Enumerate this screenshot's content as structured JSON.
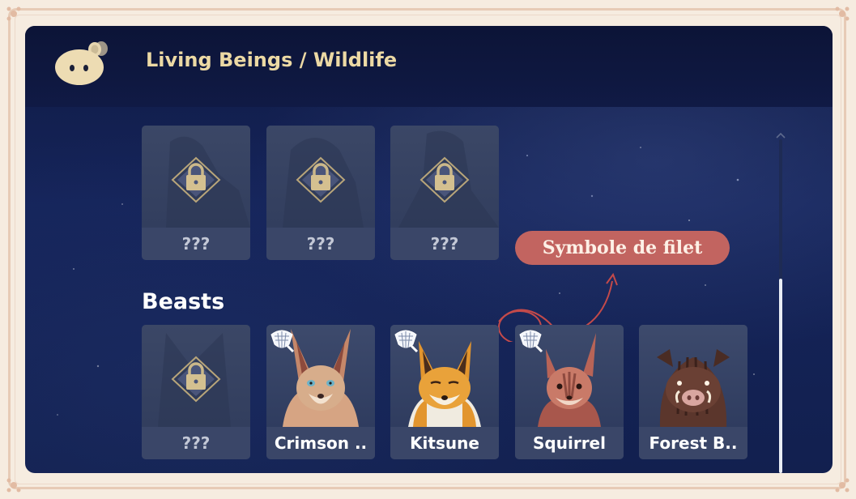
{
  "header": {
    "title": "Living Beings / Wildlife"
  },
  "locked_row": {
    "items": [
      {
        "label": "???"
      },
      {
        "label": "???"
      },
      {
        "label": "???"
      }
    ]
  },
  "beasts": {
    "section_title": "Beasts",
    "items": [
      {
        "label": "???",
        "locked": true
      },
      {
        "label": "Crimson ..",
        "locked": false,
        "icon": "net-icon"
      },
      {
        "label": "Kitsune",
        "locked": false,
        "icon": "net-icon"
      },
      {
        "label": "Squirrel",
        "locked": false,
        "icon": "net-icon"
      },
      {
        "label": "Forest B..",
        "locked": false
      }
    ]
  },
  "annotation": {
    "callout_text": "Symbole de filet"
  },
  "colors": {
    "panel_bg": "#12204f",
    "title_gold": "#ecd9a4",
    "callout": "#c26460",
    "card_label_bg": "#3a4668"
  }
}
